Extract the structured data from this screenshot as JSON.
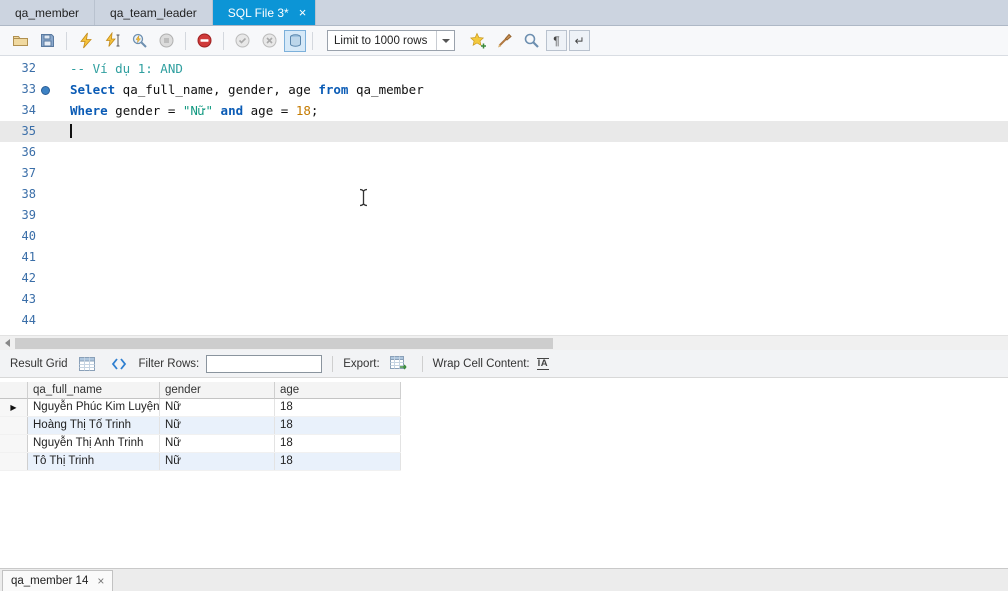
{
  "ui": {
    "close_glyph": "×",
    "row_marker_glyph": "▶",
    "pilcrow_glyph": "¶",
    "wrap_glyph": "↵",
    "wrap_cell_glyph": "IA",
    "accent_tab_color": "#0c95d6",
    "current_line_color": "#e9e9e9",
    "alt_row_color": "#e9f1fb"
  },
  "tabs": [
    {
      "label": "qa_member"
    },
    {
      "label": "qa_team_leader"
    },
    {
      "label": "SQL File 3*",
      "active": true
    }
  ],
  "toolbar": {
    "limit_label": "Limit to 1000 rows",
    "icons": [
      "open-script",
      "save-script",
      "execute",
      "execute-current-statement",
      "explain-plan",
      "stop-query",
      "toggle-stop-on-error",
      "commit",
      "rollback",
      "toggle-autocommit",
      "save-snippet",
      "beautify",
      "find",
      "invisible-characters",
      "wrap-text"
    ]
  },
  "editor": {
    "lines": [
      {
        "n": "32",
        "segs": [
          {
            "c": "cm",
            "t": "-- Ví dụ 1: AND"
          }
        ]
      },
      {
        "n": "33",
        "marker": true,
        "segs": [
          {
            "c": "kw",
            "t": "Select"
          },
          {
            "c": "pl",
            "t": " qa_full_name, gender, age "
          },
          {
            "c": "kw",
            "t": "from"
          },
          {
            "c": "pl",
            "t": " qa_member"
          }
        ]
      },
      {
        "n": "34",
        "segs": [
          {
            "c": "kw",
            "t": "Where"
          },
          {
            "c": "pl",
            "t": " gender = "
          },
          {
            "c": "st",
            "t": "\"Nữ\""
          },
          {
            "c": "pl",
            "t": " "
          },
          {
            "c": "kw",
            "t": "and"
          },
          {
            "c": "pl",
            "t": " age = "
          },
          {
            "c": "nu",
            "t": "18"
          },
          {
            "c": "pl",
            "t": ";"
          }
        ]
      },
      {
        "n": "35",
        "current": true,
        "cursor": true,
        "segs": []
      },
      {
        "n": "36",
        "segs": []
      },
      {
        "n": "37",
        "segs": []
      },
      {
        "n": "38",
        "segs": []
      },
      {
        "n": "39",
        "segs": []
      },
      {
        "n": "40",
        "segs": []
      },
      {
        "n": "41",
        "segs": []
      },
      {
        "n": "42",
        "segs": []
      },
      {
        "n": "43",
        "segs": []
      },
      {
        "n": "44",
        "segs": []
      }
    ]
  },
  "result_grid": {
    "title": "Result Grid",
    "filter_label": "Filter Rows:",
    "filter_value": "",
    "export_label": "Export:",
    "wrap_label": "Wrap Cell Content:",
    "columns": [
      "qa_full_name",
      "gender",
      "age"
    ],
    "rows": [
      [
        "Nguyễn Phúc Kim Luyện",
        "Nữ",
        "18"
      ],
      [
        "Hoàng Thị Tố Trinh",
        "Nữ",
        "18"
      ],
      [
        "Nguyễn Thị Anh Trinh",
        "Nữ",
        "18"
      ],
      [
        "Tô Thị Trinh",
        "Nữ",
        "18"
      ]
    ]
  },
  "bottom_tabs": [
    {
      "label": "qa_member 14"
    }
  ]
}
